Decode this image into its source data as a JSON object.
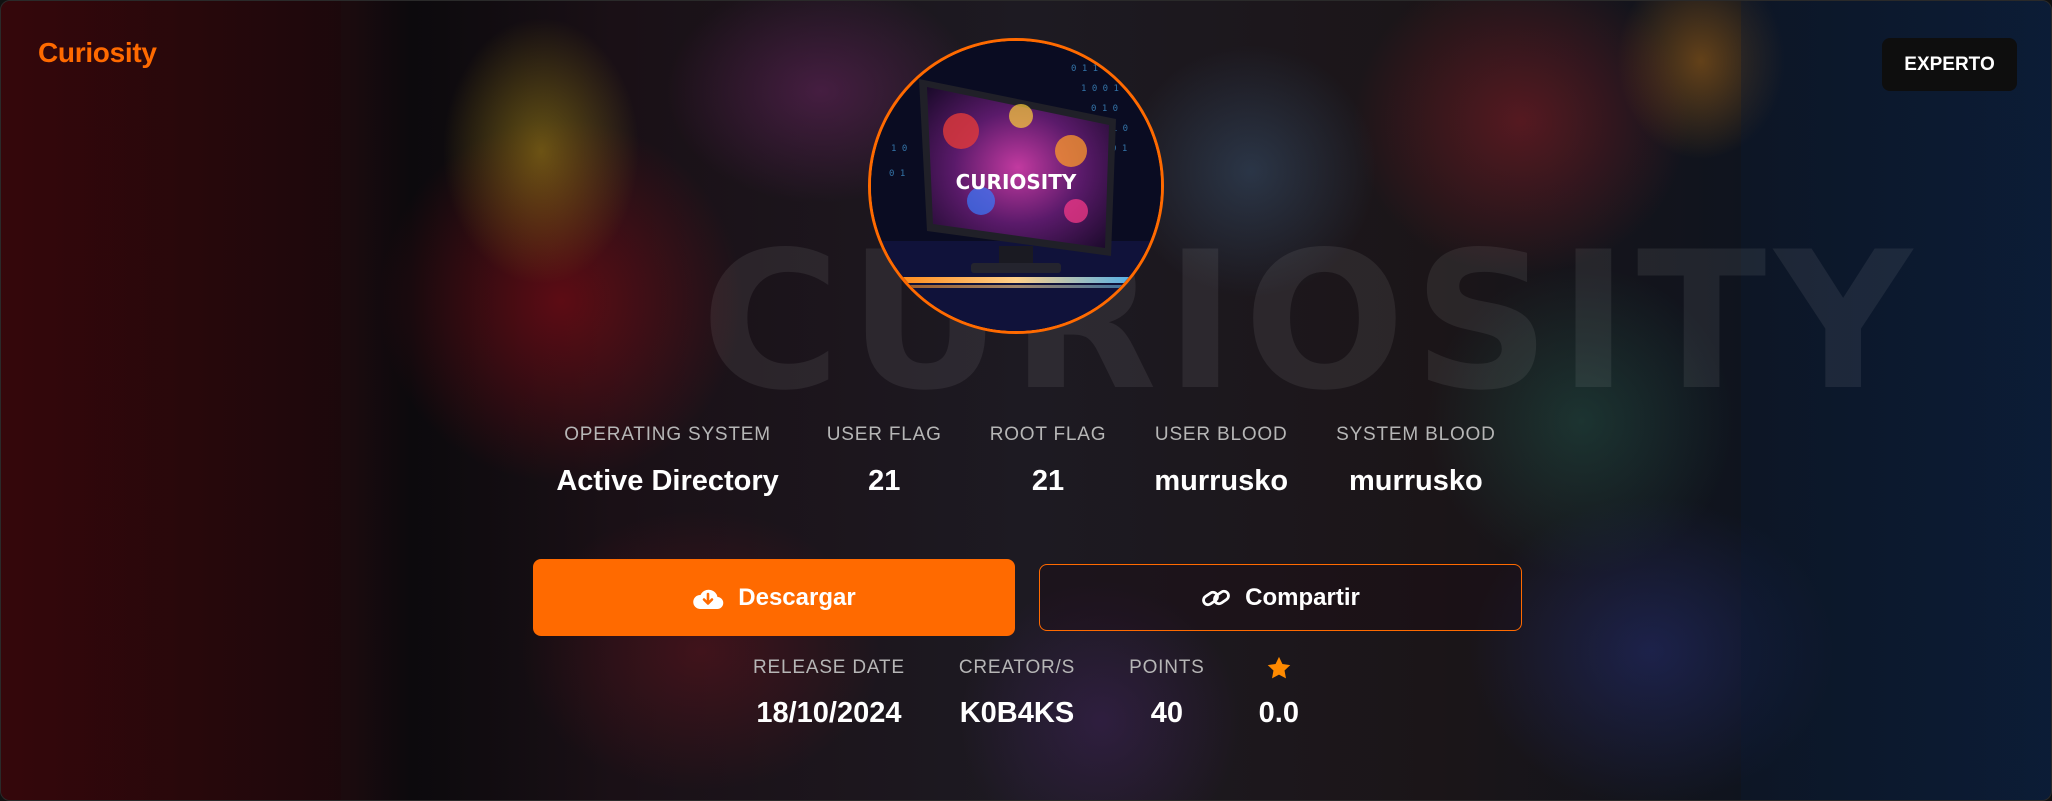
{
  "machine": {
    "name": "Curiosity",
    "difficulty": "EXPERTO",
    "avatar_text": "CURIOSITY"
  },
  "stats_primary": [
    {
      "label": "OPERATING SYSTEM",
      "value": "Active Directory"
    },
    {
      "label": "USER FLAG",
      "value": "21"
    },
    {
      "label": "ROOT FLAG",
      "value": "21"
    },
    {
      "label": "USER BLOOD",
      "value": "murrusko"
    },
    {
      "label": "SYSTEM BLOOD",
      "value": "murrusko"
    }
  ],
  "actions": {
    "download_label": "Descargar",
    "download_icon": "cloud-download-icon",
    "share_label": "Compartir",
    "share_icon": "link-icon"
  },
  "stats_secondary": [
    {
      "label": "RELEASE DATE",
      "value": "18/10/2024"
    },
    {
      "label": "CREATOR/S",
      "value": "K0B4KS"
    },
    {
      "label": "POINTS",
      "value": "40"
    },
    {
      "label_icon": "star-icon",
      "value": "0.0"
    }
  ],
  "colors": {
    "accent": "#ff6a00",
    "badge_bg": "#0e0e0e",
    "label": "#b6b6b6",
    "value": "#ffffff",
    "star": "#ff8a00"
  }
}
